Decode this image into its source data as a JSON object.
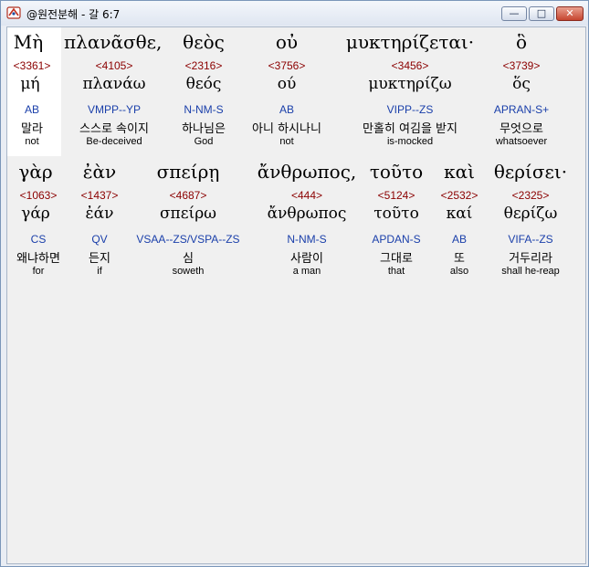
{
  "window": {
    "title": "@원전분해 - 갈 6:7",
    "min_glyph": "—",
    "max_glyph": "□",
    "close_glyph": "✕",
    "close_color": "#c6452f"
  },
  "rows": [
    {
      "words": [
        {
          "greek": "Μὴ",
          "strong": "<3361>",
          "lemma": "μή",
          "morph": "AB",
          "korean": "말라",
          "english": "not"
        },
        {
          "greek": "πλανᾶσθε,",
          "strong": "<4105>",
          "lemma": "πλανάω",
          "morph": "VMPP--YP",
          "korean": "스스로 속이지",
          "english": "Be-deceived"
        },
        {
          "greek": "θεὸς",
          "strong": "<2316>",
          "lemma": "θεός",
          "morph": "N-NM-S",
          "korean": "하나님은",
          "english": "God"
        },
        {
          "greek": "οὐ",
          "strong": "<3756>",
          "lemma": "ού",
          "morph": "AB",
          "korean": "아니 하시나니",
          "english": "not"
        },
        {
          "greek": "μυκτηρίζεται·",
          "strong": "<3456>",
          "lemma": "μυκτηρίζω",
          "morph": "VIPP--ZS",
          "korean": "만홀히 여김을 받지",
          "english": "is-mocked"
        },
        {
          "greek": "ὃ",
          "strong": "<3739>",
          "lemma": "ὅς",
          "morph": "APRAN-S+",
          "korean": "무엇으로",
          "english": "whatsoever"
        }
      ]
    },
    {
      "words": [
        {
          "greek": "γὰρ",
          "strong": "<1063>",
          "lemma": "γάρ",
          "morph": "CS",
          "korean": "왜냐하면",
          "english": "for"
        },
        {
          "greek": "ἐὰν",
          "strong": "<1437>",
          "lemma": "ἐάν",
          "morph": "QV",
          "korean": "든지",
          "english": "if"
        },
        {
          "greek": "σπείρῃ",
          "strong": "<4687>",
          "lemma": "σπείρω",
          "morph": "VSAA--ZS/VSPA--ZS",
          "korean": "심",
          "english": "soweth"
        },
        {
          "greek": "ἄνθρωπος,",
          "strong": "<444>",
          "lemma": "ἄνθρωπος",
          "morph": "N-NM-S",
          "korean": "사람이",
          "english": "a man"
        },
        {
          "greek": "τοῦτο",
          "strong": "<5124>",
          "lemma": "τοῦτο",
          "morph": "APDAN-S",
          "korean": "그대로",
          "english": "that"
        },
        {
          "greek": "καὶ",
          "strong": "<2532>",
          "lemma": "καί",
          "morph": "AB",
          "korean": "또",
          "english": "also"
        },
        {
          "greek": "θερίσει·",
          "strong": "<2325>",
          "lemma": "θερίζω",
          "morph": "VIFA--ZS",
          "korean": "거두리라",
          "english": "shall he-reap"
        }
      ]
    }
  ]
}
